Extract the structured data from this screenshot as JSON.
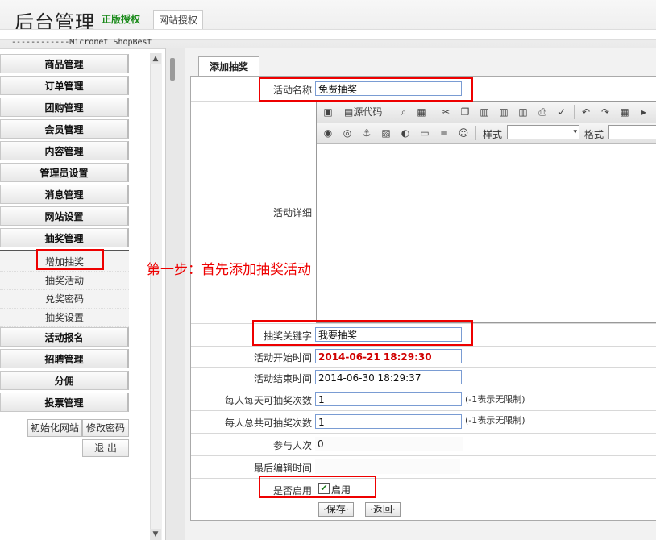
{
  "header": {
    "title": "后台管理",
    "license_official": "正版授权",
    "license_site": "网站授权",
    "brand_line": "------------Micronet ShopBest"
  },
  "sidebar": {
    "menu_top": [
      "商品管理",
      "订单管理",
      "团购管理",
      "会员管理",
      "内容管理",
      "管理员设置",
      "消息管理",
      "网站设置",
      "抽奖管理"
    ],
    "submenu": [
      "增加抽奖",
      "抽奖活动",
      "兑奖密码",
      "抽奖设置"
    ],
    "menu_bottom": [
      "活动报名",
      "招聘管理",
      "分佣",
      "投票管理"
    ],
    "init_site": "初始化网站",
    "change_password": "修改密码",
    "logout": "退 出"
  },
  "tab": {
    "label": "添加抽奖"
  },
  "form": {
    "name_label": "活动名称",
    "name_value": "免费抽奖",
    "detail_label": "活动详细",
    "keyword_label": "抽奖关键字",
    "keyword_value": "我要抽奖",
    "start_label": "活动开始时间",
    "start_value": "2014-06-21 18:29:30",
    "end_label": "活动结束时间",
    "end_value": "2014-06-30 18:29:37",
    "daily_label": "每人每天可抽奖次数",
    "daily_value": "1",
    "daily_hint": "(-1表示无限制)",
    "total_label": "每人总共可抽奖次数",
    "total_value": "1",
    "total_hint": "(-1表示无限制)",
    "participants_label": "参与人次",
    "participants_value": "0",
    "last_edit_label": "最后编辑时间",
    "enabled_label": "是否启用",
    "enabled_checkbox_label": "启用",
    "enabled": true,
    "save": "保存",
    "back": "返回"
  },
  "editor": {
    "source_label": "源代码",
    "style_label": "样式",
    "format_label": "格式"
  },
  "annotation": "第一步：首先添加抽奖活动",
  "colors": {
    "highlight_red": "#ee0000",
    "start_time_red": "#d00000",
    "license_green": "#1a8a1a"
  }
}
